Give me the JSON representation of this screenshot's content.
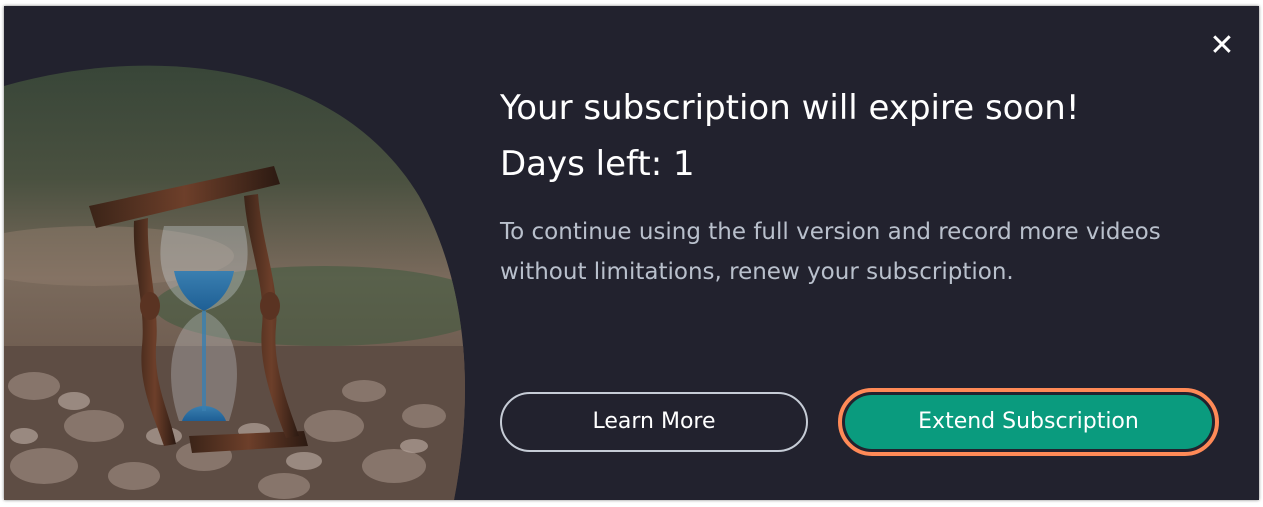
{
  "dialog": {
    "title": "Your subscription will expire soon!",
    "days_left": "Days left: 1",
    "description": "To continue using the full version and record more videos without limitations, renew your subscription.",
    "close_symbol": "✕",
    "learn_more_label": "Learn More",
    "extend_label": "Extend Subscription"
  },
  "colors": {
    "background": "#22222e",
    "accent_button": "#0a9b7e",
    "highlight_ring": "#ff8a57",
    "body_text": "#b9c0cc"
  },
  "icons": {
    "hero_image": "hourglass-on-pebbles",
    "close": "close-icon"
  }
}
